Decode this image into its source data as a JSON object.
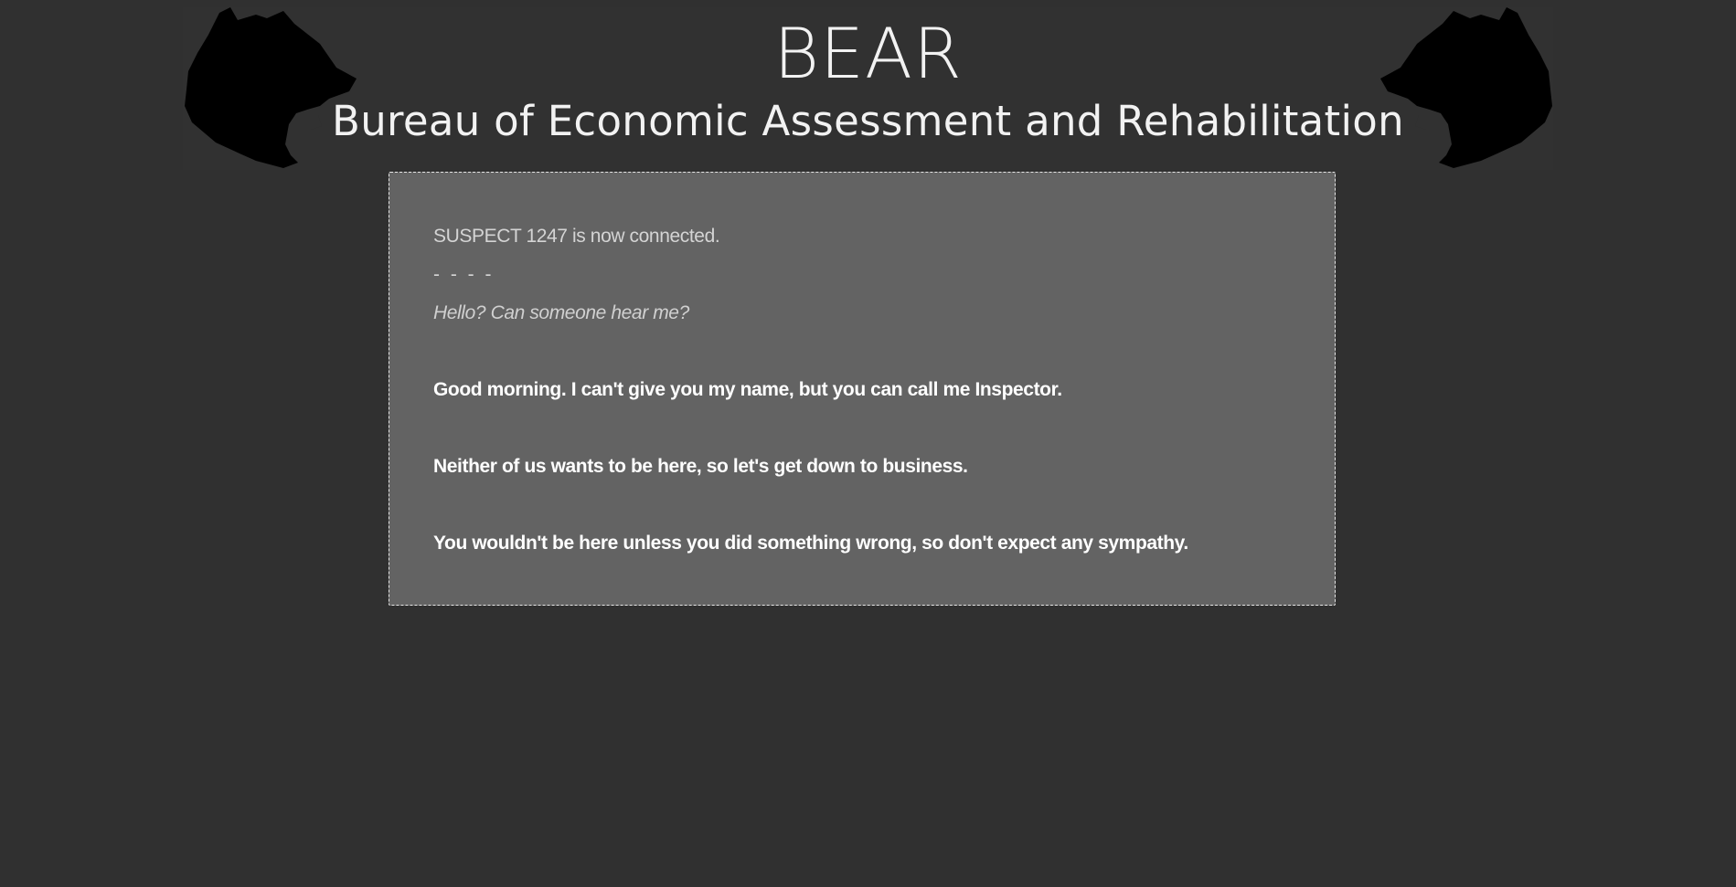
{
  "header": {
    "title": "BEAR",
    "subtitle": "Bureau of Economic Assessment and Rehabilitation",
    "logo_icon": "bear-head-silhouette-icon"
  },
  "chat": {
    "system_message": "SUSPECT 1247 is now connected.",
    "separator": "- - - -",
    "suspect_message": "Hello? Can someone hear me?",
    "inspector_messages": [
      "Good morning. I can't give you my name, but you can call me Inspector.",
      "Neither of us wants to be here, so let's get down to business.",
      "You wouldn't be here unless you did something wrong, so don't expect any sympathy."
    ]
  },
  "colors": {
    "background": "#303030",
    "panel": "#636363",
    "text_primary": "#ffffff",
    "text_muted": "#d4d4d4"
  }
}
